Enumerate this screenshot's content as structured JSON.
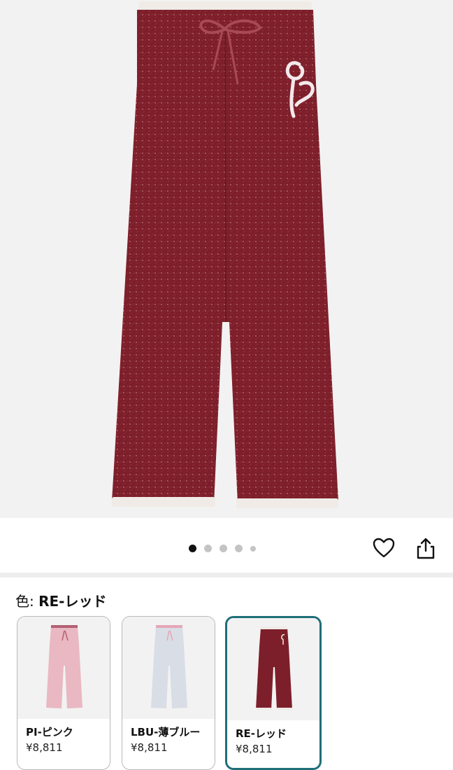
{
  "product": {
    "image_alt": "Fluffy knit lounge pants, red",
    "brand_monogram": "GP",
    "colors": {
      "red": "#7d1f2a",
      "pink": "#e9b8c2",
      "blue": "#d9dde6",
      "trim": "#f0ebe6"
    }
  },
  "gallery": {
    "pages": 5,
    "active_index": 0
  },
  "actions": {
    "favorite_icon": "heart-icon",
    "share_icon": "share-icon"
  },
  "color_selector": {
    "label_prefix": "色: ",
    "selected_value": "RE-レッド",
    "options": [
      {
        "name": "PI-ピンク",
        "price": "¥8,811",
        "color": "#e9b8c2"
      },
      {
        "name": "LBU-薄ブルー",
        "price": "¥8,811",
        "color": "#d9dde6"
      },
      {
        "name": "RE-レッド",
        "price": "¥8,811",
        "color": "#7d1f2a"
      }
    ]
  }
}
